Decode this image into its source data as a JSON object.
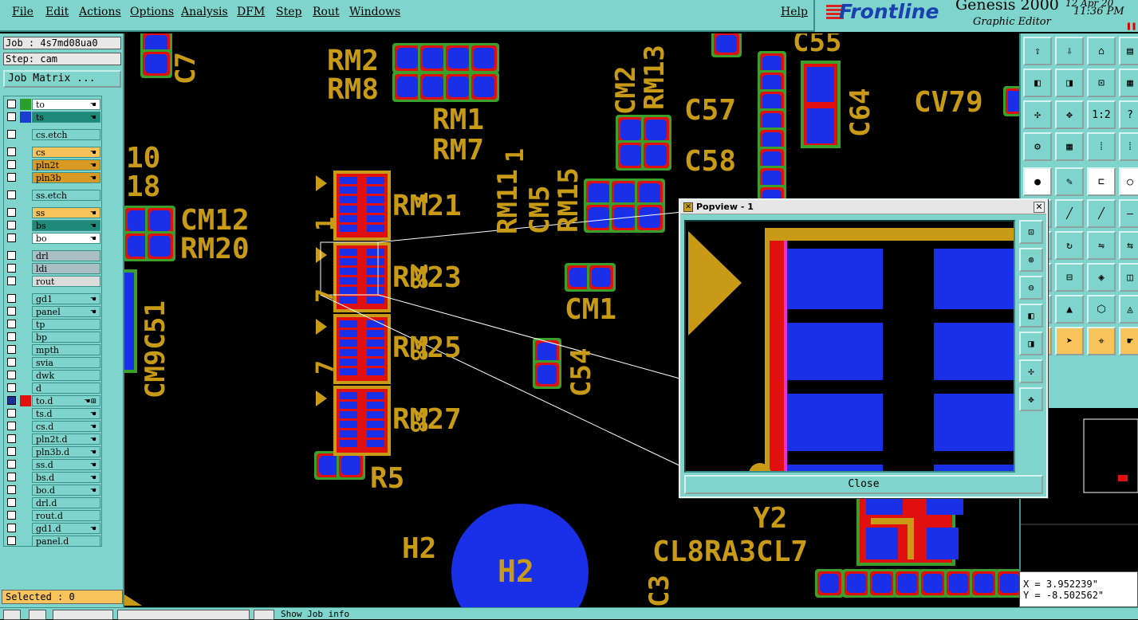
{
  "menubar": {
    "items": [
      "File",
      "Edit",
      "Actions",
      "Options",
      "Analysis",
      "DFM",
      "Step",
      "Rout",
      "Windows"
    ],
    "help": "Help"
  },
  "brand": {
    "logo": "Frontline",
    "product": "Genesis 2000",
    "subtitle": "Graphic Editor",
    "date": "12 Apr 20",
    "time": "11:36 PM"
  },
  "left_panel": {
    "job": "Job : 4s7md08ua0",
    "step": "Step: cam",
    "job_matrix_button": "Job Matrix ...",
    "selected": "Selected : 0",
    "layers": [
      {
        "name": "to",
        "color": "#ffffff",
        "swatch": "#2aa02a",
        "icon": "hand"
      },
      {
        "name": "ts",
        "color": "#1e8a7a",
        "swatch": "#1a3fd0",
        "icon": "hand"
      },
      {
        "name": "cs.etch",
        "color": "#7fd4cc",
        "swatch": "",
        "icon": ""
      },
      {
        "name": "cs",
        "color": "#f7c35a",
        "swatch": "",
        "icon": "hand"
      },
      {
        "name": "pln2t",
        "color": "#d89a22",
        "swatch": "",
        "icon": "hand"
      },
      {
        "name": "pln3b",
        "color": "#d89a22",
        "swatch": "",
        "icon": "hand"
      },
      {
        "name": "ss.etch",
        "color": "#7fd4cc",
        "swatch": "",
        "icon": ""
      },
      {
        "name": "ss",
        "color": "#f7c35a",
        "swatch": "",
        "icon": "hand"
      },
      {
        "name": "bs",
        "color": "#1e8a7a",
        "swatch": "",
        "icon": "hand"
      },
      {
        "name": "bo",
        "color": "#ffffff",
        "swatch": "",
        "icon": "hand"
      },
      {
        "name": "drl",
        "color": "#a9bfc4",
        "swatch": "",
        "icon": ""
      },
      {
        "name": "ldi",
        "color": "#a9bfc4",
        "swatch": "",
        "icon": ""
      },
      {
        "name": "rout",
        "color": "#dcdcdc",
        "swatch": "",
        "icon": ""
      },
      {
        "name": "gd1",
        "color": "#7fd4cc",
        "swatch": "",
        "icon": "hand"
      },
      {
        "name": "panel",
        "color": "#7fd4cc",
        "swatch": "",
        "icon": "hand"
      },
      {
        "name": "tp",
        "color": "#7fd4cc",
        "swatch": "",
        "icon": ""
      },
      {
        "name": "bp",
        "color": "#7fd4cc",
        "swatch": "",
        "icon": ""
      },
      {
        "name": "mpth",
        "color": "#7fd4cc",
        "swatch": "",
        "icon": ""
      },
      {
        "name": "svia",
        "color": "#7fd4cc",
        "swatch": "",
        "icon": ""
      },
      {
        "name": "dwk",
        "color": "#7fd4cc",
        "swatch": "",
        "icon": ""
      },
      {
        "name": "d",
        "color": "#7fd4cc",
        "swatch": "",
        "icon": ""
      },
      {
        "name": "to.d",
        "color": "#7fd4cc",
        "swatch": "#e01010",
        "icon": "hand-grid",
        "active": true
      },
      {
        "name": "ts.d",
        "color": "#7fd4cc",
        "swatch": "",
        "icon": "hand"
      },
      {
        "name": "cs.d",
        "color": "#7fd4cc",
        "swatch": "",
        "icon": "hand"
      },
      {
        "name": "pln2t.d",
        "color": "#7fd4cc",
        "swatch": "",
        "icon": "hand"
      },
      {
        "name": "pln3b.d",
        "color": "#7fd4cc",
        "swatch": "",
        "icon": "hand"
      },
      {
        "name": "ss.d",
        "color": "#7fd4cc",
        "swatch": "",
        "icon": "hand"
      },
      {
        "name": "bs.d",
        "color": "#7fd4cc",
        "swatch": "",
        "icon": "hand"
      },
      {
        "name": "bo.d",
        "color": "#7fd4cc",
        "swatch": "",
        "icon": "hand"
      },
      {
        "name": "drl.d",
        "color": "#7fd4cc",
        "swatch": "",
        "icon": ""
      },
      {
        "name": "rout.d",
        "color": "#7fd4cc",
        "swatch": "",
        "icon": ""
      },
      {
        "name": "gd1.d",
        "color": "#7fd4cc",
        "swatch": "",
        "icon": "hand"
      },
      {
        "name": "panel.d",
        "color": "#7fd4cc",
        "swatch": "",
        "icon": ""
      }
    ]
  },
  "canvas": {
    "labels": [
      "RM2",
      "RM8",
      "RM1",
      "RM7",
      "CM2",
      "RM13",
      "C57",
      "C58",
      "C55",
      "C64",
      "CV79",
      "C7",
      "10",
      "18",
      "CM12",
      "RM20",
      "RM21",
      "RM23",
      "RM25",
      "RM27",
      "RM11",
      "CM5",
      "RM15",
      "CM1",
      "C54",
      "R5",
      "CM9C51",
      "H2",
      "H2",
      "Y2",
      "CL8RA3CL7",
      "C3",
      "1",
      "1",
      "7",
      "7",
      "7",
      "28",
      "28",
      "28",
      "28"
    ]
  },
  "popview": {
    "title": "Popview - 1",
    "close_label": "Close"
  },
  "coords": {
    "x": "X = 3.952239\"",
    "y": "Y = -8.502562\""
  },
  "status": {
    "message": "Show Job info"
  },
  "colors": {
    "panel": "#7fd4cc",
    "pad": "#1a2fe8",
    "silk": "#c89a16",
    "mask": "#e01010",
    "outline": "#3aa02a"
  }
}
